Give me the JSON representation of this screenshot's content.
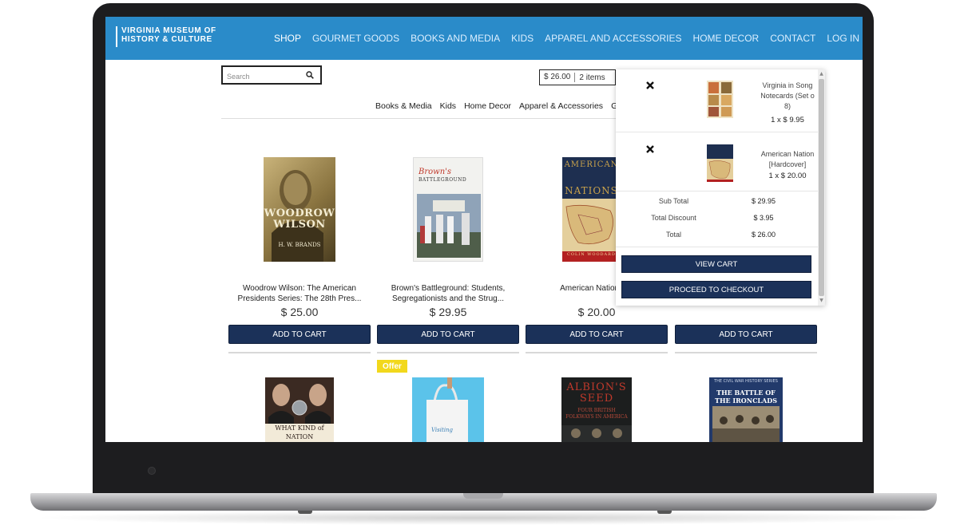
{
  "brand": {
    "logo_line1": "VIRGINIA MUSEUM OF",
    "logo_line2": "HISTORY & CULTURE"
  },
  "nav": {
    "items": [
      "SHOP",
      "GOURMET GOODS",
      "BOOKS AND MEDIA",
      "KIDS",
      "APPAREL AND ACCESSORIES",
      "HOME DECOR",
      "CONTACT",
      "LOG IN"
    ],
    "active": "SHOP"
  },
  "search": {
    "placeholder": "Search",
    "value": ""
  },
  "cart_summary": {
    "amount": "$ 26.00",
    "items": "2 items"
  },
  "subnav": {
    "items": [
      "Books & Media",
      "Kids",
      "Home Decor",
      "Apparel & Accessories",
      "G"
    ]
  },
  "products": [
    {
      "title": "Woodrow Wilson: The American Presidents Series: The 28th Pres...",
      "price": "$ 25.00",
      "button": "ADD TO CART",
      "cover_text": "WOODROW WILSON",
      "cover_author": "H. W. BRANDS"
    },
    {
      "title": "Brown's Battleground: Students, Segregationists and the Strug...",
      "price": "$ 29.95",
      "button": "ADD TO CART",
      "cover_text": "Brown's",
      "cover_sub": "BATTLEGROUND"
    },
    {
      "title": "American Nations [H",
      "price": "$ 20.00",
      "button": "ADD TO CART",
      "cover_text": "AMERICAN",
      "cover_sub": "NATIONS",
      "cover_author": "COLIN WOODARD"
    },
    {
      "title": "",
      "price": "",
      "button": "ADD TO CART"
    }
  ],
  "products_row2": [
    {
      "cover_text": "WHAT KIND of NATION"
    },
    {
      "cover_text": "Visiting",
      "badge": "Offer"
    },
    {
      "cover_text": "ALBION'S SEED",
      "cover_sub": "FOUR BRITISH FOLKWAYS IN AMERICA"
    },
    {
      "cover_text": "THE BATTLE OF THE IRONCLADS",
      "cover_sub": "THE CIVIL WAR HISTORY SERIES"
    }
  ],
  "minicart": {
    "items": [
      {
        "name_line1": "Virginia in Song",
        "name_line2": "Notecards (Set o",
        "name_line3": "8)",
        "qty": "1 x $ 9.95"
      },
      {
        "name_line1": "American Nation",
        "name_line2": "[Hardcover]",
        "qty": "1 x $ 20.00"
      }
    ],
    "summary": [
      {
        "label": "Sub Total",
        "value": "$ 29.95"
      },
      {
        "label": "Total Discount",
        "value": "$ 3.95"
      },
      {
        "label": "Total",
        "value": "$ 26.00"
      }
    ],
    "view_cart": "VIEW CART",
    "checkout": "PROCEED TO CHECKOUT"
  },
  "colors": {
    "header": "#2a8bc9",
    "button": "#1b3159",
    "offer": "#f2d81c"
  }
}
